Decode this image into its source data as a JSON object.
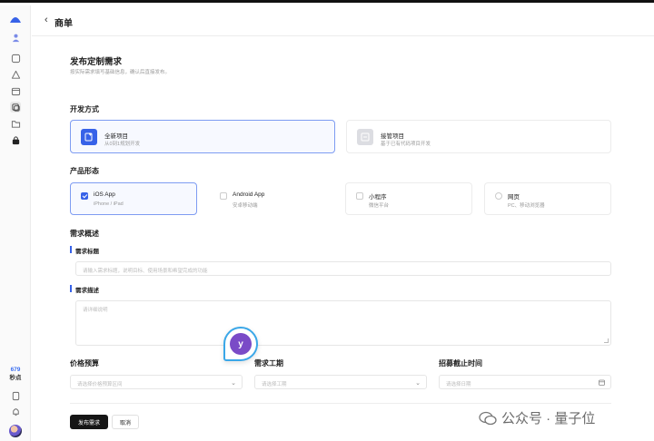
{
  "header": {
    "title": "商单"
  },
  "sidebar": {
    "credits_value": "679",
    "credits_label": "秒点"
  },
  "page": {
    "title": "发布定制需求",
    "subtitle": "按实际需求填写基础信息，确认后直接发布。"
  },
  "dev_mode": {
    "heading": "开发方式",
    "options": [
      {
        "title": "全新项目",
        "desc": "从0到1规划开发",
        "selected": true
      },
      {
        "title": "接管项目",
        "desc": "基于已有代码项目开发",
        "selected": false
      }
    ]
  },
  "product": {
    "heading": "产品形态",
    "options": [
      {
        "title": "iOS App",
        "desc": "iPhone / iPad",
        "selected": true
      },
      {
        "title": "Android App",
        "desc": "安卓移动端",
        "selected": false
      },
      {
        "title": "小程序",
        "desc": "微信平台",
        "selected": false
      },
      {
        "title": "网页",
        "desc": "PC、移动浏览器",
        "selected": false
      }
    ]
  },
  "overview": {
    "heading": "需求概述",
    "title_label": "需求标题",
    "title_placeholder": "请输入需求标题，说明目标、使用场景和希望完成的功能",
    "desc_label": "需求描述",
    "desc_placeholder": "请详细说明"
  },
  "budget": {
    "label": "价格预算",
    "placeholder": "请选择价格预算区间"
  },
  "period": {
    "label": "需求工期",
    "placeholder": "请选择工期"
  },
  "deadline": {
    "label": "招募截止时间",
    "placeholder": "请选择日期"
  },
  "actions": {
    "submit": "发布需求",
    "cancel": "取消"
  },
  "bubble": {
    "letter": "y"
  },
  "watermark": {
    "text": "公众号 · 量子位"
  },
  "colors": {
    "accent": "#3762e8",
    "primary_button": "#151515",
    "selected_border": "#7e9cf2"
  }
}
